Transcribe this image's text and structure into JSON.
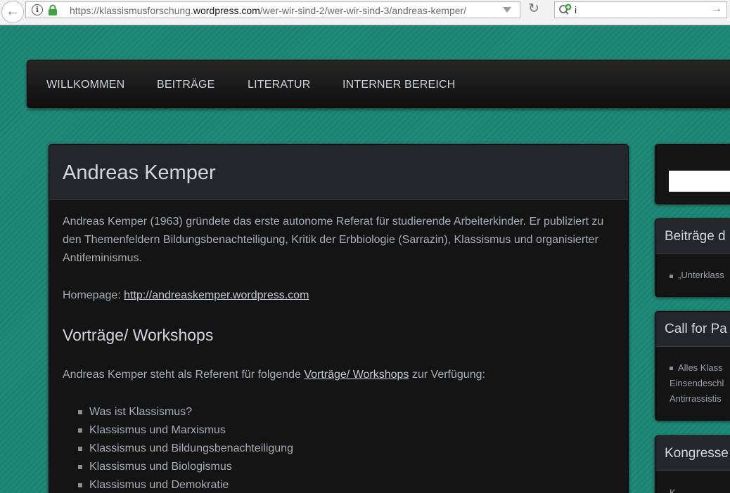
{
  "browser": {
    "url_prefix": "https://klassismusforschung.",
    "url_host": "wordpress.com",
    "url_path": "/wer-wir-sind-2/wer-wir-sind-3/andreas-kemper/",
    "search_value": "i"
  },
  "nav": {
    "items": [
      "WILLKOMMEN",
      "BEITRÄGE",
      "LITERATUR",
      "INTERNER BEREICH"
    ]
  },
  "article": {
    "title": "Andreas Kemper",
    "intro": "Andreas Kemper (1963) gründete das erste autonome Referat für studierende Arbeiterkinder. Er publiziert zu den Themenfeldern Bildungsbenachteiligung, Kritik der Erbbiologie (Sarrazin), Klassismus und organisierter Antifeminismus.",
    "homepage_label": "Homepage: ",
    "homepage_link": "http://andreaskemper.wordpress.com",
    "workshops_heading": "Vorträge/ Workshops",
    "workshops_before": "Andreas Kemper steht als Referent für folgende ",
    "workshops_link": "Vorträge/ Workshops",
    "workshops_after": " zur Verfügung:",
    "topics": [
      "Was ist Klassismus?",
      "Klassismus und Marxismus",
      "Klassismus und Bildungsbenachteiligung",
      "Klassismus und Biologismus",
      "Klassismus und Demokratie"
    ]
  },
  "sidebar": {
    "posts_title": "Beiträge d",
    "posts_item": "„Unterklass",
    "call_title": "Call for Pa",
    "call_lines": [
      "Alles Klass",
      "Einsendeschl",
      "Antirrassistis"
    ],
    "kong_title": "Kongresse",
    "kong_line": "K"
  },
  "colors": {
    "background": "#1f8a78",
    "panel": "#141414",
    "panel_header": "#24262c",
    "text": "#a8adb4",
    "heading": "#d3d6dc"
  }
}
